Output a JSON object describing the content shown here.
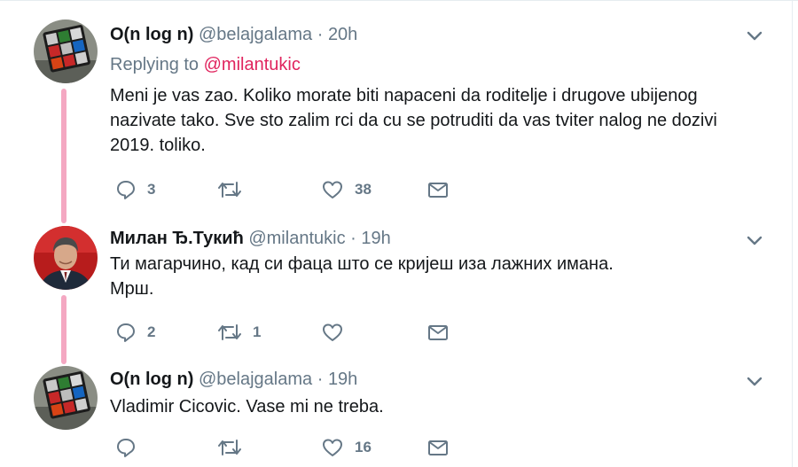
{
  "tweets": [
    {
      "name": "O(n log n)",
      "handle": "@belajgalama",
      "separator": "·",
      "time": "20h",
      "replying_to_label": "Replying to",
      "replying_to_handle": "@milantukic",
      "text": "Meni je vas zao. Koliko morate biti napaceni da roditelje i drugove ubijenog nazivate tako. Sve sto zalim rci da cu se potruditi da vas tviter nalog ne dozivi 2019. toliko.",
      "replies": "3",
      "retweets": "",
      "likes": "38",
      "avatar_icon": "rubiks-cube-avatar"
    },
    {
      "name": "Милан Ђ.Тукић",
      "handle": "@milantukic",
      "separator": "·",
      "time": "19h",
      "text": "Ти магарчино, кад си фаца што се кријеш иза лажних имана.\nМрш.",
      "replies": "2",
      "retweets": "1",
      "likes": "",
      "avatar_icon": "man-portrait-avatar"
    },
    {
      "name": "O(n log n)",
      "handle": "@belajgalama",
      "separator": "·",
      "time": "19h",
      "text": "Vladimir Cicovic. Vase mi ne treba.",
      "replies": "",
      "retweets": "",
      "likes": "16",
      "avatar_icon": "rubiks-cube-avatar"
    }
  ],
  "colors": {
    "text": "#14171a",
    "secondary": "#657786",
    "mention": "#e0245e",
    "thread_line": "#f4a8c2"
  }
}
